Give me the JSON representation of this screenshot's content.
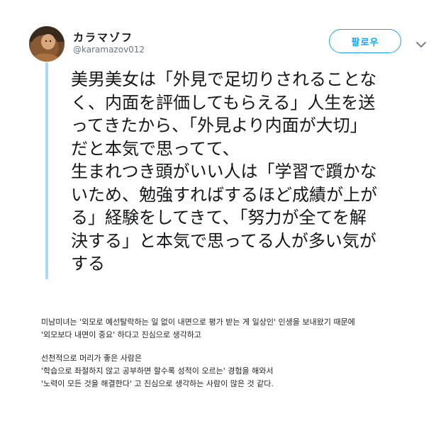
{
  "tweet": {
    "display_name": "カラマゾフ",
    "handle": "@karamazov012",
    "follow_label": "팔로우",
    "lines": [
      "美男美女は「外見で足切りされることな",
      "く、内面を評価してもらえる」人生を送",
      "ってきたから、「外見より内面が大切」",
      "だと本気で思ってて、",
      "生まれつき頭がいい人は「学習で躓かな",
      "いため、勉強すればするほど成績が上が",
      "る」経験をしてきて、「努力が全てを解",
      "決する」と本気で思ってる人が多い気が",
      "する"
    ]
  },
  "icons": {
    "avatar": "avatar-portrait",
    "menu": "chevron-down-icon"
  },
  "colors": {
    "accent": "#1da1f2",
    "thread_line": "#a9d8f3",
    "secondary_text": "#657786"
  },
  "translation": {
    "paragraph1": [
      "미남미녀는 '외모로 예선탈락하는 일 없이 내면으로 평가 받는 게 일상인' 인생을 보내왔기 때문에",
      "'외모보다 내면이 중요' 하다고 진심으로 생각하고"
    ],
    "paragraph2": [
      "선천적으로 머리가 좋은 사람은",
      "'학습으로 좌절하지 않고 공부하면 할수록 성적이 오르는' 경험을 해와서",
      "'노력이 모든 것을 해결한다' 고 진심으로 생각하는 사람이 많은 것 같다."
    ]
  }
}
